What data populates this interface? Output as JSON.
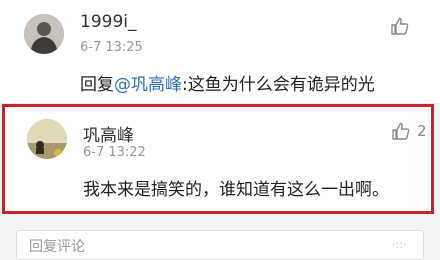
{
  "comments": [
    {
      "username": "1999i_",
      "time": "6-7 13:25",
      "reply_prefix": "回复",
      "mention": "@巩高峰",
      "text": ":这鱼为什么会有诡异的光",
      "likes": ""
    },
    {
      "username": "巩高峰",
      "time": "6-7 13:22",
      "text": "我本来是搞笑的，谁知道有这么一出啊。",
      "likes": "2"
    }
  ],
  "reply_bar": {
    "placeholder": "回复评论"
  },
  "corner_mark": "·::·",
  "colors": {
    "highlight_border": "#c8232c",
    "mention": "#2f6fb6"
  }
}
